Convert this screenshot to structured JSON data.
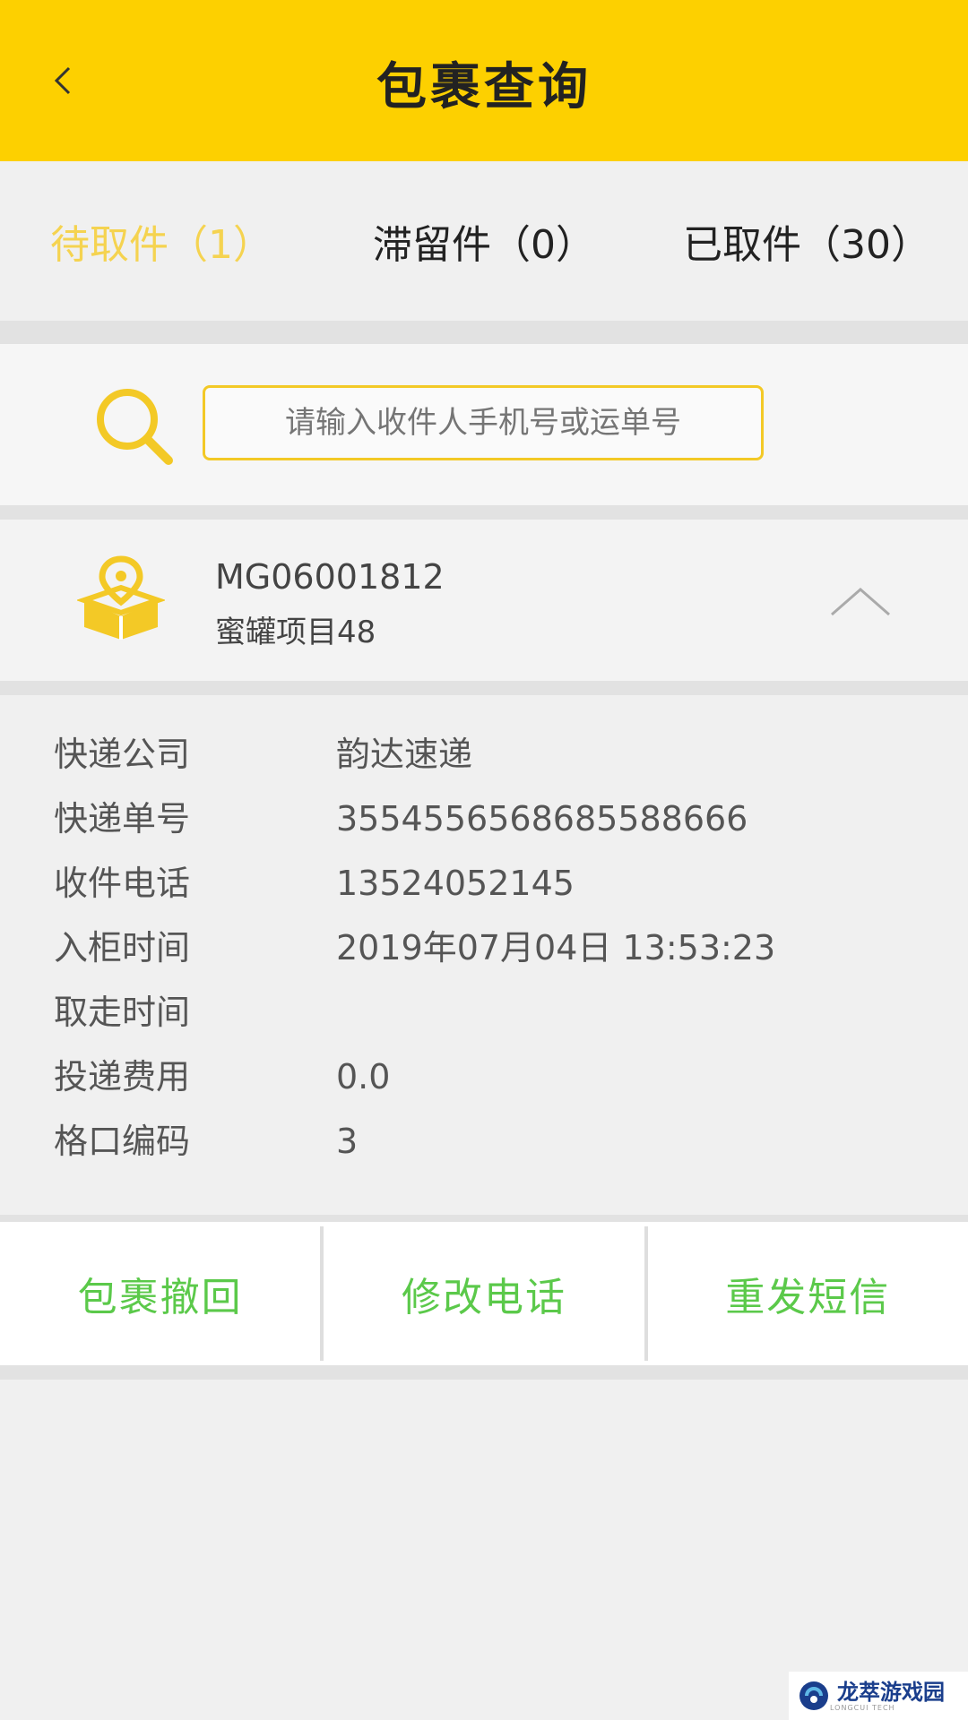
{
  "header": {
    "title": "包裹查询",
    "back_icon": "chevron-left-icon",
    "background_color": "#fdd000"
  },
  "tabs": [
    {
      "label": "待取件（1）",
      "active": true
    },
    {
      "label": "滞留件（0）",
      "active": false
    },
    {
      "label": "已取件（30）",
      "active": false
    }
  ],
  "search": {
    "placeholder": "请输入收件人手机号或运单号",
    "icon": "search-icon"
  },
  "package": {
    "code": "MG06001812",
    "name": "蜜罐项目48",
    "icon": "package-location-icon",
    "toggle_icon": "chevron-up-icon"
  },
  "details": {
    "rows": [
      {
        "label": "快递公司",
        "value": "韵达速递"
      },
      {
        "label": "快递单号",
        "value": "3554556568685588666"
      },
      {
        "label": "收件电话",
        "value": "13524052145"
      },
      {
        "label": "入柜时间",
        "value": "2019年07月04日 13:53:23"
      },
      {
        "label": "取走时间",
        "value": ""
      },
      {
        "label": "投递费用",
        "value": "0.0"
      },
      {
        "label": "格口编码",
        "value": "3"
      }
    ]
  },
  "actions": [
    {
      "label": "包裹撤回"
    },
    {
      "label": "修改电话"
    },
    {
      "label": "重发短信"
    }
  ],
  "watermark": {
    "text": "龙萃游戏园",
    "sub": "LONGCUI TECH"
  },
  "colors": {
    "accent": "#fdd000",
    "active_tab": "#f5d350",
    "action_text": "#5bc94a"
  }
}
